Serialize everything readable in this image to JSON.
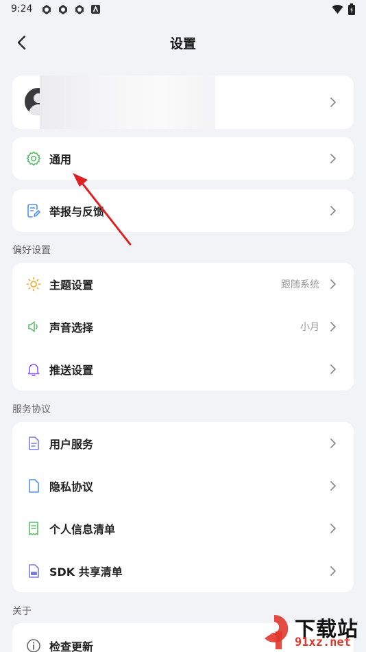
{
  "status_bar": {
    "time": "9:24"
  },
  "header": {
    "title": "设置"
  },
  "menu": {
    "general": "通用",
    "report": "举报与反馈"
  },
  "preferences": {
    "section_title": "偏好设置",
    "theme": {
      "label": "主题设置",
      "value": "跟随系统"
    },
    "sound": {
      "label": "声音选择",
      "value": "小月"
    },
    "push": {
      "label": "推送设置"
    }
  },
  "agreements": {
    "section_title": "服务协议",
    "user_service": "用户服务",
    "privacy": "隐私协议",
    "personal_info": "个人信息清单",
    "sdk": "SDK 共享清单"
  },
  "about": {
    "section_title": "关于",
    "check_update": "检查更新"
  },
  "watermark": {
    "brand": "下载站",
    "url": "91xz.net"
  },
  "colors": {
    "background": "#f2f3f7",
    "general_icon": "#5cc06b",
    "report_icon": "#4f8ff7",
    "theme_icon": "#f5a623",
    "sound_icon": "#5cc06b",
    "push_icon": "#8e5cf7",
    "doc_icon": "#7a7fe6",
    "list_icon": "#5cc06b",
    "arrow": "#e02020"
  }
}
